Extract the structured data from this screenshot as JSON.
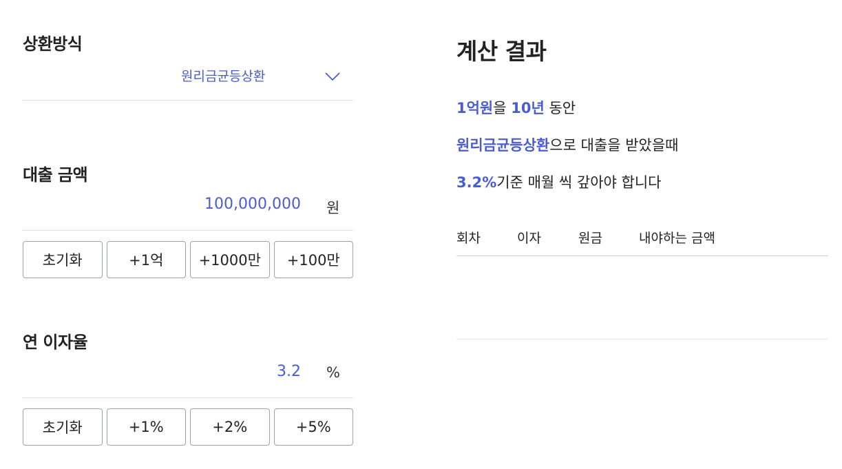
{
  "repayment": {
    "title": "상환방식",
    "selected": "원리금균등상환",
    "chevron_icon": "chevron-down-icon"
  },
  "loan": {
    "title": "대출 금액",
    "value": "100,000,000",
    "unit": "원",
    "buttons": [
      "초기화",
      "+1억",
      "+1000만",
      "+100만"
    ]
  },
  "rate": {
    "title": "연 이자율",
    "value": "3.2",
    "unit": "%",
    "buttons": [
      "초기화",
      "+1%",
      "+2%",
      "+5%"
    ]
  },
  "result": {
    "title": "계산 결과",
    "line1": {
      "amount": "1억원",
      "t1": "을 ",
      "years": "10년",
      "t2": " 동안"
    },
    "line2": {
      "method": "원리금균등상환",
      "t1": "으로 대출을 받았을때"
    },
    "line3": {
      "rate": "3.2%",
      "t1": "기준 매월 씩 갚아야 합니다"
    },
    "table_headers": [
      "회차",
      "이자",
      "원금",
      "내야하는 금액"
    ]
  },
  "colors": {
    "accent": "#4a5bd4",
    "border": "#dcdcdc",
    "button_border": "#9aa3ad"
  }
}
